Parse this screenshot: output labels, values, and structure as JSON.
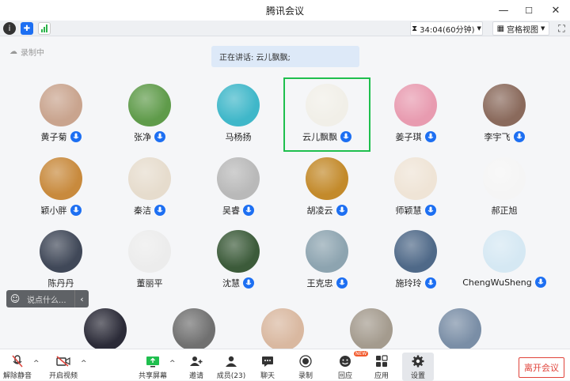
{
  "window": {
    "title": "腾讯会议",
    "minimize": "—",
    "maximize": "☐",
    "close": "✕"
  },
  "toolbar": {
    "timer": "34:04(60分钟)",
    "view": "宫格视图"
  },
  "recording": "录制中",
  "speaking": "正在讲话: 云儿飘飘;",
  "participants": [
    {
      "name": "黄子菊",
      "mic": true,
      "color": "#c9a48e"
    },
    {
      "name": "张净",
      "mic": true,
      "color": "#5f9b4a"
    },
    {
      "name": "马杨扬",
      "mic": false,
      "color": "#3fb7c9"
    },
    {
      "name": "云儿飘飘",
      "mic": true,
      "color": "#f1efe8",
      "active": true
    },
    {
      "name": "姜子琪",
      "mic": true,
      "color": "#e89bb0"
    },
    {
      "name": "李宇飞",
      "mic": true,
      "color": "#8a6a5c"
    },
    {
      "name": "颖小胖",
      "mic": true,
      "color": "#c88a3d"
    },
    {
      "name": "秦洁",
      "mic": true,
      "color": "#e6dccd"
    },
    {
      "name": "吴睿",
      "mic": true,
      "color": "#b9b9b9"
    },
    {
      "name": "胡凌云",
      "mic": true,
      "color": "#c38a2b"
    },
    {
      "name": "师颖慧",
      "mic": true,
      "color": "#efe4d6"
    },
    {
      "name": "郝正旭",
      "mic": false,
      "color": "#f5f5f5"
    },
    {
      "name": "陈丹丹",
      "mic": false,
      "color": "#404858"
    },
    {
      "name": "董丽平",
      "mic": false,
      "color": "#ececec"
    },
    {
      "name": "沈慧",
      "mic": true,
      "color": "#3c5b3a"
    },
    {
      "name": "王克忠",
      "mic": true,
      "color": "#8da4b0"
    },
    {
      "name": "施玲玲",
      "mic": true,
      "color": "#4f6988"
    },
    {
      "name": "ChengWuSheng",
      "mic": true,
      "color": "#d5e8f3"
    },
    {
      "name": "",
      "mic": false,
      "color": "#2b2b38"
    },
    {
      "name": "",
      "mic": false,
      "color": "#707070"
    },
    {
      "name": "",
      "mic": false,
      "color": "#d9b8a0"
    },
    {
      "name": "",
      "mic": false,
      "color": "#a49b8e"
    },
    {
      "name": "",
      "mic": false,
      "color": "#7a8ea6"
    }
  ],
  "chat": {
    "placeholder": "说点什么..."
  },
  "bottom": {
    "unmute": "解除静音",
    "video": "开启视频",
    "share": "共享屏幕",
    "invite": "邀请",
    "members": "成员(23)",
    "chat": "聊天",
    "record": "录制",
    "reaction": "回应",
    "apps": "应用",
    "settings": "设置",
    "leave": "离开会议",
    "new": "NEW"
  },
  "colors": {
    "accent": "#1d6ff2",
    "active_border": "#1fbf4e",
    "leave": "#e0433a"
  }
}
